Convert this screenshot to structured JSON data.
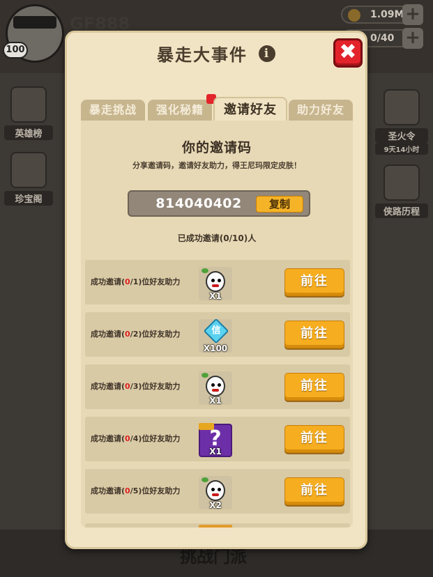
{
  "background": {
    "player_name": "GF888",
    "level": "100",
    "resources": [
      {
        "value": "1.09M"
      },
      {
        "value": "0/40"
      }
    ],
    "side_left": [
      {
        "label": "英雄榜"
      },
      {
        "label": "珍宝阁"
      }
    ],
    "side_right": [
      {
        "label": "圣火令",
        "sub": "9天14小时"
      },
      {
        "label": "侠路历程"
      }
    ],
    "bottom_title": "挑战门派"
  },
  "modal": {
    "title": "暴走大事件",
    "tabs": [
      {
        "label": "暴走挑战",
        "active": false,
        "badge": false
      },
      {
        "label": "强化秘籍",
        "active": false,
        "badge": true
      },
      {
        "label": "邀请好友",
        "active": true,
        "badge": false
      },
      {
        "label": "助力好友",
        "active": false,
        "badge": false
      }
    ],
    "invite": {
      "heading": "你的邀请码",
      "description": "分享邀请码，邀请好友助力，得王尼玛限定皮肤！",
      "code": "814040402",
      "copy_label": "复制",
      "status": "已成功邀请(0/10)人"
    },
    "tasks": [
      {
        "prefix": "成功邀请(",
        "done": "0",
        "suffix": "/1)位好友助力",
        "reward": "face",
        "qty": "X1",
        "button": "前往"
      },
      {
        "prefix": "成功邀请(",
        "done": "0",
        "suffix": "/2)位好友助力",
        "reward": "gem",
        "gem_char": "信",
        "qty": "X100",
        "button": "前往"
      },
      {
        "prefix": "成功邀请(",
        "done": "0",
        "suffix": "/3)位好友助力",
        "reward": "face",
        "qty": "X1",
        "button": "前往"
      },
      {
        "prefix": "成功邀请(",
        "done": "0",
        "suffix": "/4)位好友助力",
        "reward": "mystery",
        "qmark": "?",
        "qty": "X1",
        "button": "前往"
      },
      {
        "prefix": "成功邀请(",
        "done": "0",
        "suffix": "/5)位好友助力",
        "reward": "face",
        "qty": "X2",
        "button": "前往"
      }
    ]
  }
}
